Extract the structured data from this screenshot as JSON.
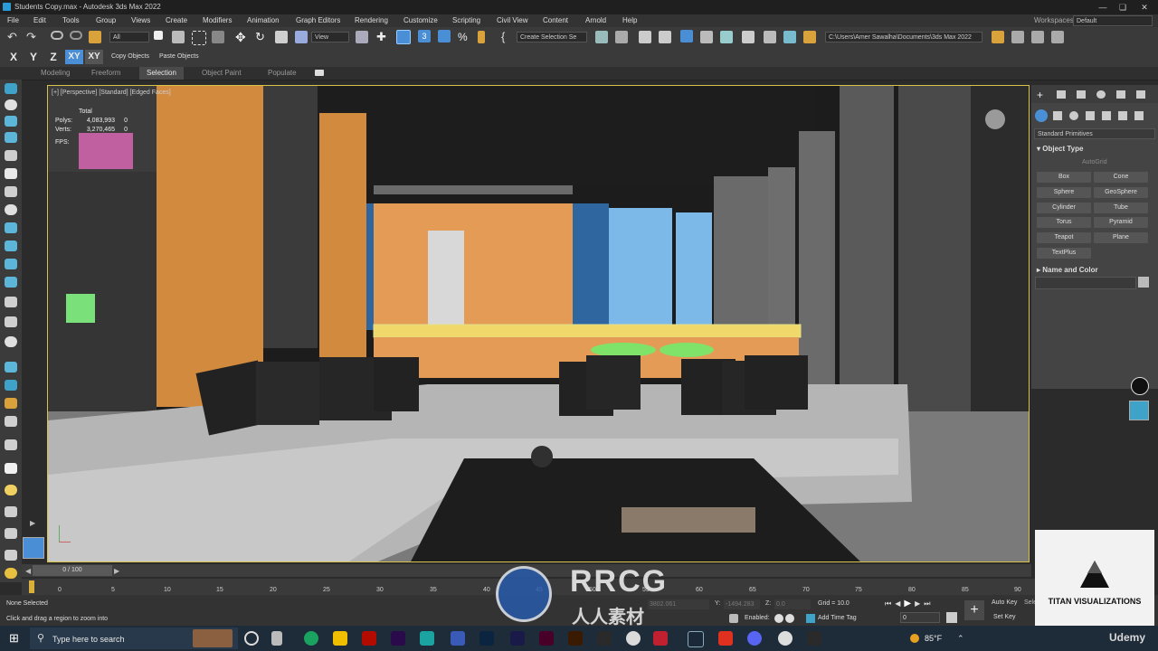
{
  "titlebar": {
    "title": "Students Copy.max - Autodesk 3ds Max 2022"
  },
  "menu": {
    "items": [
      "File",
      "Edit",
      "Tools",
      "Group",
      "Views",
      "Create",
      "Modifiers",
      "Animation",
      "Graph Editors",
      "Rendering",
      "Customize",
      "Scripting",
      "Civil View",
      "Content",
      "Arnold",
      "Help"
    ],
    "workspaces_label": "Workspaces:",
    "workspace_value": "Default"
  },
  "toolbar": {
    "filter_value": "All",
    "ref_coord_value": "View",
    "named_selection_value": "Create Selection Se",
    "project_path": "C:\\Users\\Amer Sawalha\\Documents\\3ds Max 2022",
    "axis_x": "X",
    "axis_y": "Y",
    "axis_z": "Z",
    "axis_xy": "XY",
    "axis_xy2": "XY",
    "copy_objects": "Copy Objects",
    "paste_objects": "Paste Objects"
  },
  "ribbon": {
    "tabs": [
      "Modeling",
      "Freeform",
      "Selection",
      "Object Paint",
      "Populate"
    ],
    "active": "Selection"
  },
  "viewport": {
    "label": "[+] [Perspective] [Standard] [Edged Faces]",
    "stats": {
      "total_label": "Total",
      "polys_label": "Polys:",
      "polys": "4,083,993",
      "polys_sel": "0",
      "verts_label": "Verts:",
      "verts": "3,270,465",
      "verts_sel": "0",
      "fps_label": "FPS:"
    }
  },
  "command_panel": {
    "category": "Standard Primitives",
    "object_type": "Object Type",
    "autogrid": "AutoGrid",
    "buttons": [
      "Box",
      "Cone",
      "Sphere",
      "GeoSphere",
      "Cylinder",
      "Tube",
      "Torus",
      "Pyramid",
      "Teapot",
      "Plane",
      "TextPlus"
    ],
    "name_and_color": "Name and Color"
  },
  "timeline": {
    "frame_counter": "0 / 100",
    "ticks": [
      "0",
      "5",
      "10",
      "15",
      "20",
      "25",
      "30",
      "35",
      "40",
      "45",
      "50",
      "55",
      "60",
      "65",
      "70",
      "75",
      "80",
      "85",
      "90"
    ]
  },
  "status": {
    "selection": "None Selected",
    "prompt": "Click and drag a region to zoom into",
    "x_value": "3802.061",
    "y_label": "Y:",
    "y_value": "-1494.283",
    "z_label": "Z:",
    "z_value": "0.0",
    "grid": "Grid = 10.0",
    "enabled_label": "Enabled:",
    "add_time_tag": "Add Time Tag",
    "auto_key": "Auto Key",
    "set_key": "Set Key",
    "selected_label": "Selected",
    "frame_value": "0",
    "sel_short": "Selec"
  },
  "taskbar": {
    "search_placeholder": "Type here to search",
    "weather": "85°F",
    "udemy": "Udemy"
  },
  "overlay": {
    "titan": "TITAN VISUALIZATIONS",
    "rrcg": "RRCG",
    "rrcg_sub": "人人素材"
  }
}
